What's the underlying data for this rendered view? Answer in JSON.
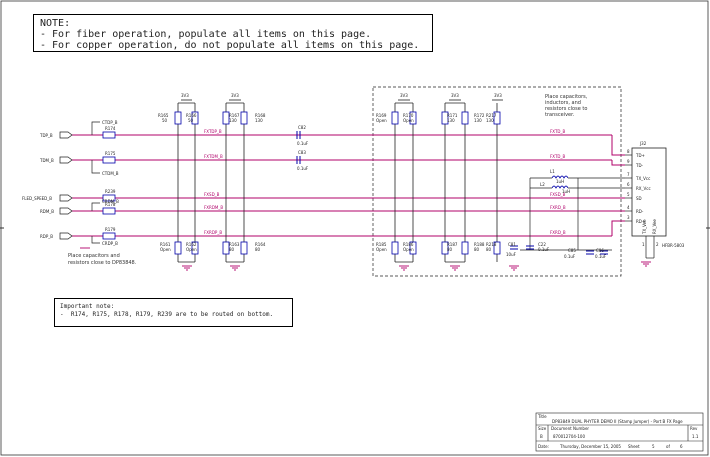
{
  "notes": {
    "top": {
      "title": "NOTE:",
      "line1": "- For fiber operation, populate all items on this page.",
      "line2": "- For copper operation, do not populate all items on this page."
    },
    "important": {
      "title": "Important note:",
      "line1": "-  R174, R175, R178, R179, R239 are to be routed on bottom."
    }
  },
  "comments": {
    "left_1": "Place capacitors and",
    "left_2": "resistors close to DP83848.",
    "right_1": "Place capacitors,",
    "right_2": "inductors, and",
    "right_3": "resistors close to",
    "right_4": "transceiver."
  },
  "ports": {
    "tdp": "TDP_B",
    "tdm": "TDM_B",
    "fled": "FLED_SPEED_B",
    "rdm": "RDM_B",
    "rdp": "RDP_B"
  },
  "nets": {
    "ctdp": "CTDP_B",
    "ctdm": "CTDM_B",
    "crdm": "CRDM_B",
    "crdp": "CRDP_B",
    "fxtdp": "FXTDP_B",
    "fxtdm": "FXTDM_B",
    "fxsd": "FXSD_B",
    "fxrdm": "FXRDM_B",
    "fxrdp": "FXRDP_B",
    "fxtdp_r": "FXTD_B",
    "fxtdm_r": "FXTD_B",
    "fxsd_r": "FXSD_B",
    "fxrdm_r": "FXRD_B",
    "fxrdp_r": "FXRD_B"
  },
  "power": {
    "p1": "3V3",
    "p2": "3V3",
    "p3": "3V3",
    "p4": "3V3",
    "p5": "3V3"
  },
  "parts": {
    "r165": [
      "R165",
      "50"
    ],
    "r166": [
      "R166",
      "50"
    ],
    "r167": [
      "R167",
      "130"
    ],
    "r168": [
      "R168",
      "130"
    ],
    "r169": [
      "R169",
      "Open"
    ],
    "r170": [
      "R170",
      "Open"
    ],
    "r171": [
      "R171",
      "130"
    ],
    "r172": [
      "R172",
      "130"
    ],
    "r217": [
      "R217",
      "130"
    ],
    "r161": [
      "R161",
      "Open"
    ],
    "r162": [
      "R162",
      "Open"
    ],
    "r163": [
      "R163",
      "80"
    ],
    "r164": [
      "R164",
      "80"
    ],
    "r165b": [
      "R185",
      "Open"
    ],
    "r186": [
      "R186",
      "Open"
    ],
    "r187": [
      "R187",
      "80"
    ],
    "r188": [
      "R188",
      "80"
    ],
    "r218": [
      "R218",
      "80"
    ],
    "r239": "R239",
    "r178": "R178",
    "r174": "R174",
    "r175": "R175",
    "r179": "R179",
    "c82": [
      "C82",
      "0.1uF"
    ],
    "c83": [
      "C83",
      "0.1uF"
    ],
    "c81": [
      "C81",
      "10uF"
    ],
    "c22": [
      "C22",
      "0.1uF"
    ],
    "c85": [
      "C85",
      "0.1uF"
    ],
    "c86": [
      "C86",
      "0.1uF"
    ],
    "l1": [
      "L1",
      "1uH"
    ],
    "l2": [
      "L2",
      "1uH"
    ],
    "j32": [
      "J32",
      "HFBR-5803"
    ]
  },
  "connector": {
    "pin_labels": [
      "TD+",
      "TD-",
      "TX_Vcc",
      "RX_Vcc",
      "SD",
      "RD-",
      "RD+",
      "TX_Vee",
      "RX_Vee"
    ],
    "pin_numbers": [
      "8",
      "9",
      "7",
      "6",
      "5",
      "4",
      "3",
      "1",
      "2"
    ]
  },
  "title_block": {
    "title_label": "Title",
    "title": "DP83849 DUAL PHYTER DEMO II (Stamp Jumper) - Port B FX Page",
    "size_label": "Size",
    "size": "B",
    "doc_label": "Document Number",
    "doc": "870012704-100",
    "rev_label": "Rev",
    "rev": "1.1",
    "date_label": "Date:",
    "date": "Thursday, December 15, 2005",
    "sheet_label": "Sheet",
    "sheet": "5",
    "of_label": "of",
    "of": "6"
  },
  "colors": {
    "wire": "#b0006a",
    "line": "#222222",
    "comp": "#0000aa"
  }
}
